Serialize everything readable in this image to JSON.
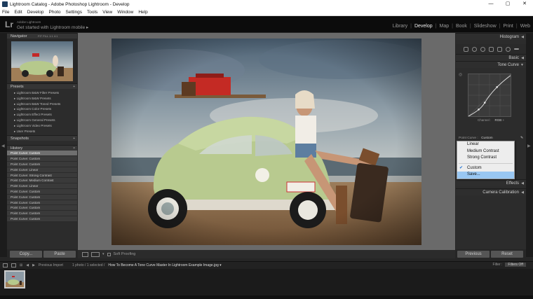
{
  "window": {
    "title": "Lightroom Catalog - Adobe Photoshop Lightroom - Develop",
    "controls": [
      "—",
      "▢",
      "✕"
    ]
  },
  "menu": [
    "File",
    "Edit",
    "Develop",
    "Photo",
    "Settings",
    "Tools",
    "View",
    "Window",
    "Help"
  ],
  "identity": {
    "logo": "Lr",
    "product": "Adobe Lightroom",
    "mobile_prompt": "Get started with Lightroom mobile ▸"
  },
  "modules": [
    "Library",
    "Develop",
    "Map",
    "Book",
    "Slideshow",
    "Print",
    "Web"
  ],
  "active_module": "Develop",
  "left_panel": {
    "navigator": {
      "title": "Navigator",
      "zoom": [
        "FIT",
        "FILL",
        "1:1",
        "4:1"
      ]
    },
    "presets": {
      "title": "Presets",
      "items": [
        "Lightroom B&W Filter Presets",
        "Lightroom B&W Presets",
        "Lightroom B&W Toned Presets",
        "Lightroom Color Presets",
        "Lightroom Effect Presets",
        "Lightroom General Presets",
        "Lightroom Video Presets",
        "User Presets"
      ]
    },
    "snapshots": {
      "title": "Snapshots"
    },
    "history": {
      "title": "History",
      "items": [
        "Point Curve: Custom",
        "Point Curve: Custom",
        "Point Curve: Custom",
        "Point Curve: Linear",
        "Point Curve: Strong Contrast",
        "Point Curve: Medium Contrast",
        "Point Curve: Linear",
        "Point Curve: Custom",
        "Point Curve: Custom",
        "Point Curve: Custom",
        "Point Curve: Custom",
        "Point Curve: Custom",
        "Point Curve: Custom"
      ]
    },
    "copy_label": "Copy...",
    "paste_label": "Paste"
  },
  "right_panel": {
    "histogram": "Histogram",
    "basic": "Basic",
    "tone_curve": "Tone Curve",
    "channel_label": "Channel :",
    "channel_value": "RGB ÷",
    "point_curve_label": "Point Curve :",
    "point_curve_value": "Custom",
    "effects": "Effects",
    "camera_calibration": "Camera Calibration",
    "previous_label": "Previous",
    "reset_label": "Reset"
  },
  "dropdown": {
    "items": [
      "Linear",
      "Medium Contrast",
      "Strong Contrast"
    ],
    "checked": "Custom",
    "highlighted": "Save..."
  },
  "toolbar": {
    "soft_proofing": "Soft Proofing"
  },
  "filmbar": {
    "previous_import": "Previous Import",
    "count": "1 photo / 1 selected /",
    "filename": "How To Become A Tone Curve Master In Lightroom Example Image.jpg ▾",
    "filter_label": "Filter :",
    "filter_value": "Filters Off"
  }
}
